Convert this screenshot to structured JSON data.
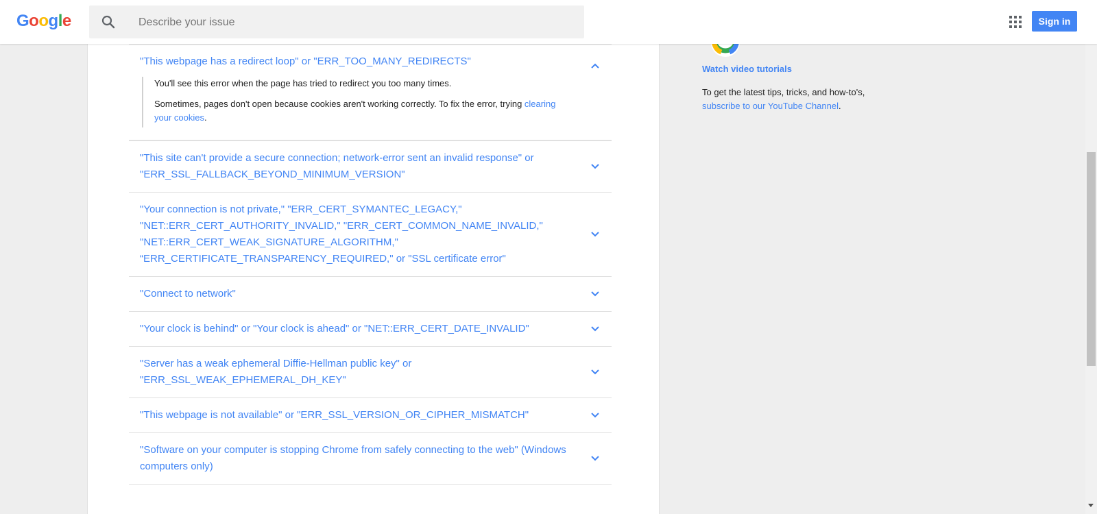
{
  "header": {
    "logo_letters": [
      "G",
      "o",
      "o",
      "g",
      "l",
      "e"
    ],
    "search_placeholder": "Describe your issue",
    "signin_label": "Sign in"
  },
  "faq": {
    "expanded": {
      "question": "\"This webpage has a redirect loop\" or \"ERR_TOO_MANY_REDIRECTS\"",
      "answer_p1": "You'll see this error when the page has tried to redirect you too many times.",
      "answer_p2_before": "Sometimes, pages don't open because cookies aren't working correctly. To fix the error, trying ",
      "answer_p2_link": "clearing your cookies",
      "answer_p2_after": "."
    },
    "items": [
      {
        "question": "\"This site can't provide a secure connection; network-error sent an invalid response\" or \"ERR_SSL_FALLBACK_BEYOND_MINIMUM_VERSION\""
      },
      {
        "question": "\"Your connection is not private,\" \"ERR_CERT_SYMANTEC_LEGACY,\" \"NET::ERR_CERT_AUTHORITY_INVALID,\" \"ERR_CERT_COMMON_NAME_INVALID,\" \"NET::ERR_CERT_WEAK_SIGNATURE_ALGORITHM,\" “ERR_CERTIFICATE_TRANSPARENCY_REQUIRED,\" or \"SSL certificate error\""
      },
      {
        "question": "\"Connect to network\""
      },
      {
        "question": "\"Your clock is behind\" or \"Your clock is ahead\" or \"NET::ERR_CERT_DATE_INVALID\""
      },
      {
        "question": "\"Server has a weak ephemeral Diffie-Hellman public key\" or \"ERR_SSL_WEAK_EPHEMERAL_DH_KEY\""
      },
      {
        "question": "\"This webpage is not available\" or \"ERR_SSL_VERSION_OR_CIPHER_MISMATCH\""
      },
      {
        "question": "\"Software on your computer is stopping Chrome from safely connecting to the web\" (Windows computers only)"
      }
    ]
  },
  "sidebar": {
    "watch_label": "Watch video tutorials",
    "tip_before": "To get the latest tips, tricks, and how-to's, ",
    "tip_link": "subscribe to our YouTube Channel",
    "tip_after": "."
  },
  "colors": {
    "link": "#4285f4",
    "google_blue": "#4285f4",
    "google_red": "#ea4335",
    "google_yellow": "#fbbc05",
    "google_green": "#34a853"
  },
  "icons": {
    "search": "search-icon",
    "apps": "apps-grid-icon",
    "chevron_up": "chevron-up-icon",
    "chevron_down": "chevron-down-icon",
    "chrome": "chrome-logo-icon"
  }
}
